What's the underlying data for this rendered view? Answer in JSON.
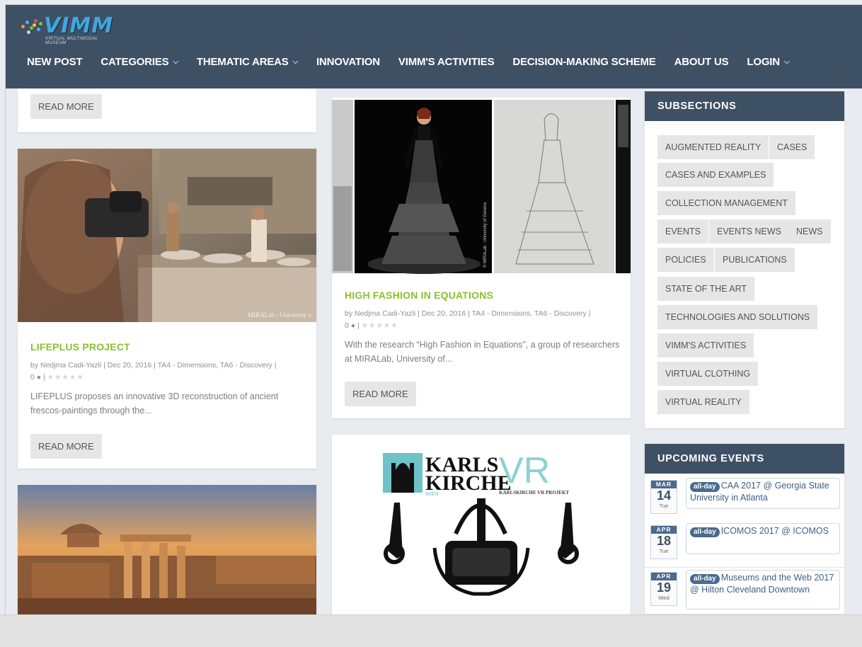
{
  "site": {
    "logo_text": "VIMM",
    "logo_sub": "VIRTUAL MULTIMODAL MUSEUM"
  },
  "nav": [
    {
      "label": "NEW POST",
      "has_dropdown": false
    },
    {
      "label": "CATEGORIES",
      "has_dropdown": true
    },
    {
      "label": "THEMATIC AREAS",
      "has_dropdown": true
    },
    {
      "label": "INNOVATION",
      "has_dropdown": false
    },
    {
      "label": "VIMM'S ACTIVITIES",
      "has_dropdown": false
    },
    {
      "label": "DECISION-MAKING SCHEME",
      "has_dropdown": false
    },
    {
      "label": "ABOUT US",
      "has_dropdown": false
    },
    {
      "label": "LOGIN",
      "has_dropdown": true
    }
  ],
  "posts": {
    "top_card": {
      "read_more": "READ MORE"
    },
    "lifeplus": {
      "image_caption": "MIRALab - University o",
      "title": "LIFEPLUS PROJECT",
      "meta_line1": "by Nedjma Cadi-Yazli | Dec 20, 2016 | TA4 - Dimensions, TA6 - Discovery |",
      "comments": "0",
      "excerpt": "LIFEPLUS proposes an innovative 3D reconstruction of ancient frescos-paintings through the...",
      "read_more": "READ MORE"
    },
    "fashion": {
      "image_caption": "© MIRALab - University of Geneva",
      "title": "HIGH FASHION IN EQUATIONS",
      "meta_line1": "by Nedjma Cadi-Yazli | Dec 20, 2016 | TA4 - Dimensions, TA6 - Discovery |",
      "comments": "0",
      "excerpt": "With the research “High Fashion in Equations”, a group of researchers at MIRALab, University of...",
      "read_more": "READ MORE"
    },
    "karlskirche": {
      "logo_line1": "KARLS",
      "logo_line2": "KIRCHE",
      "logo_vr": "VR",
      "logo_wien": "WIEN",
      "logo_project": "KARLSKIRCHE VR PROJEKT"
    }
  },
  "sidebar": {
    "subsections": {
      "title": "SUBSECTIONS",
      "tags": [
        "AUGMENTED REALITY",
        "CASES",
        "CASES AND EXAMPLES",
        "COLLECTION MANAGEMENT",
        "EVENTS",
        "EVENTS NEWS",
        "NEWS",
        "POLICIES",
        "PUBLICATIONS",
        "STATE OF THE ART",
        "TECHNOLOGIES AND SOLUTIONS",
        "VIMM'S ACTIVITIES",
        "VIRTUAL CLOTHING",
        "VIRTUAL REALITY"
      ]
    },
    "events": {
      "title": "UPCOMING EVENTS",
      "items": [
        {
          "month": "MAR",
          "day": "14",
          "dow": "Tue",
          "badge": "all-day",
          "text": "CAA 2017 @ Georgia State University in Atlanta"
        },
        {
          "month": "APR",
          "day": "18",
          "dow": "Tue",
          "badge": "all-day",
          "text": "ICOMOS 2017 @ ICOMOS"
        },
        {
          "month": "APR",
          "day": "19",
          "dow": "Wed",
          "badge": "all-day",
          "text": "Museums and the Web 2017 @ Hilton Cleveland Downtown"
        }
      ]
    }
  },
  "colors": {
    "header_bg": "#3e5064",
    "title_green": "#8cbf2e",
    "event_blue": "#4a6a8e"
  }
}
